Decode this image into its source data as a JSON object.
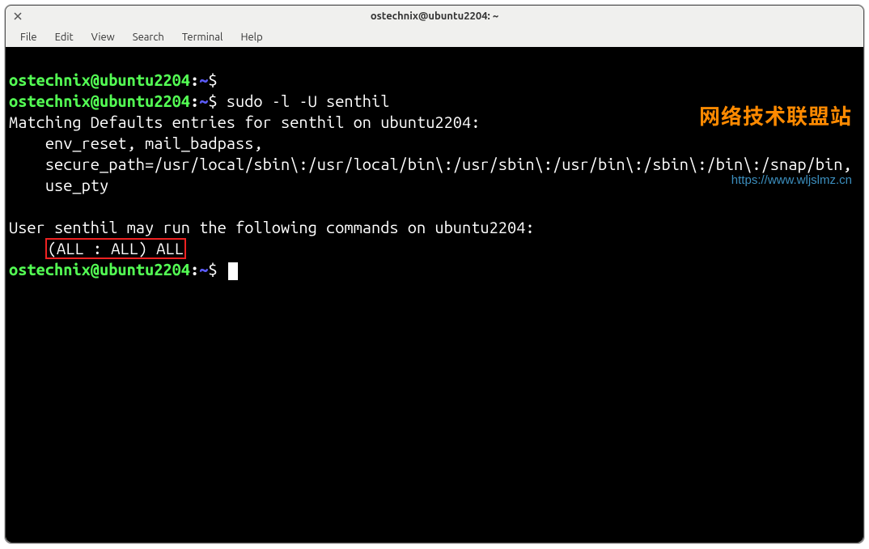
{
  "window": {
    "title": "ostechnix@ubuntu2204: ~"
  },
  "menubar": {
    "items": [
      "File",
      "Edit",
      "View",
      "Search",
      "Terminal",
      "Help"
    ]
  },
  "watermark": {
    "text_cn": "网络技术联盟站",
    "url": "https://www.wljslmz.cn"
  },
  "prompt": {
    "user_host": "ostechnix@ubuntu2204",
    "sep": ":",
    "path": "~",
    "dollar": "$"
  },
  "lines": {
    "cmd1_after": " ",
    "cmd2_after": " sudo -l -U senthil",
    "out1": "Matching Defaults entries for senthil on ubuntu2204:",
    "out2": "    env_reset, mail_badpass,",
    "out3": "    secure_path=/usr/local/sbin\\:/usr/local/bin\\:/usr/sbin\\:/usr/bin\\:/sbin\\:/bin\\:/snap/bin,",
    "out4": "    use_pty",
    "blank": "",
    "out5": "User senthil may run the following commands on ubuntu2204:",
    "out6_indent": "    ",
    "out6_highlight": "(ALL : ALL) ALL",
    "cmd3_after": " "
  }
}
